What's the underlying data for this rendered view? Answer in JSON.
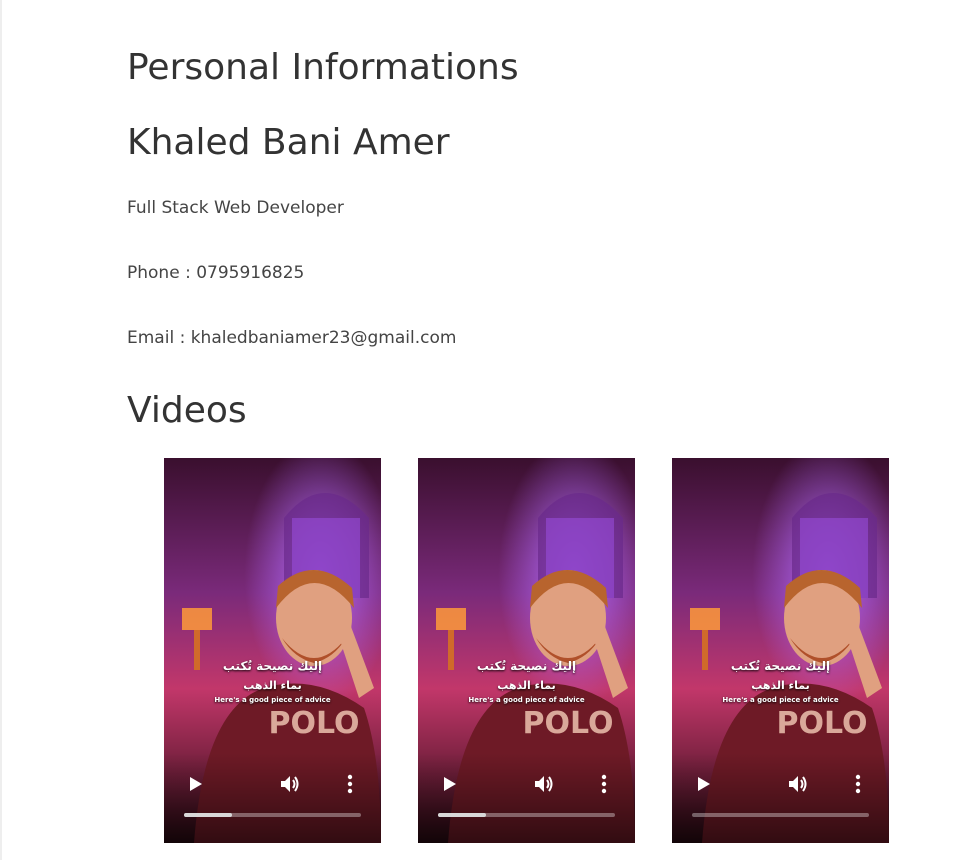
{
  "sections": {
    "personal_title": "Personal Informations",
    "name": "Khaled Bani Amer",
    "role": "Full Stack Web Developer",
    "phone": "Phone : 0795916825",
    "email": "Email : khaledbaniamer23@gmail.com",
    "videos_title": "Videos"
  },
  "videos": [
    {
      "caption_ar_line1": "إليك نصيحة تُكتب",
      "caption_ar_line2": "بماء الذهب",
      "caption_en": "Here's a good piece of advice",
      "shirt_text": "POLO",
      "progress": 0.27
    },
    {
      "caption_ar_line1": "إليك نصيحة تُكتب",
      "caption_ar_line2": "بماء الذهب",
      "caption_en": "Here's a good piece of advice",
      "shirt_text": "POLO",
      "progress": 0.27
    },
    {
      "caption_ar_line1": "إليك نصيحة تُكتب",
      "caption_ar_line2": "بماء الذهب",
      "caption_en": "Here's a good piece of advice",
      "shirt_text": "POLO",
      "progress": 0
    }
  ],
  "icons": {
    "play": "play-icon",
    "volume": "volume-icon",
    "more": "more-vertical-icon"
  },
  "colors": {
    "heading": "#333333",
    "text": "#444444",
    "video_backdrop_purple": "#8a2bd6",
    "video_backdrop_pink": "#e0457a",
    "shirt_maroon": "#6e1a26"
  }
}
